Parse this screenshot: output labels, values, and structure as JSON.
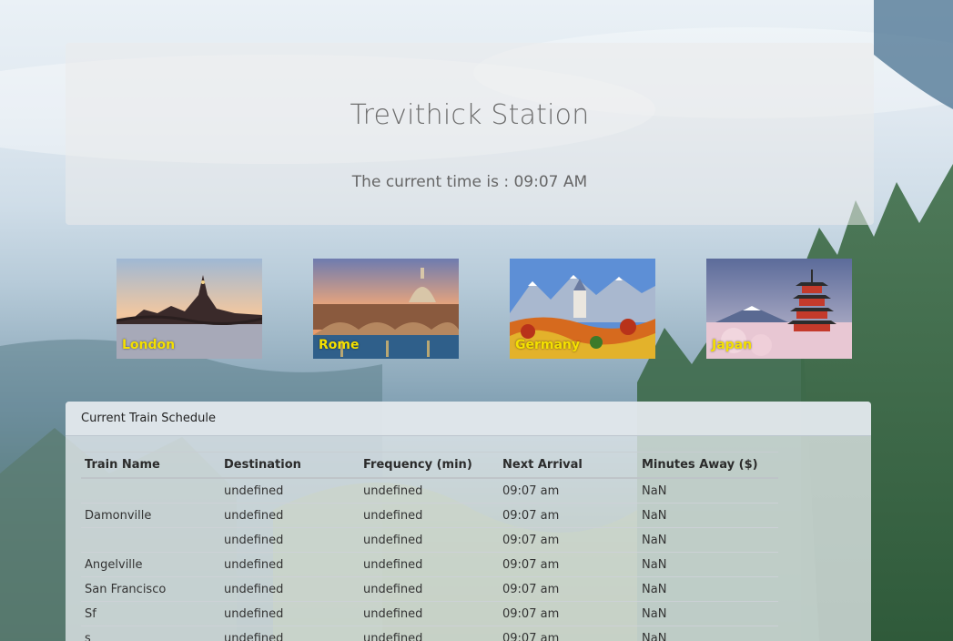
{
  "header": {
    "title": "Trevithick Station",
    "time_prefix": "The current time is : ",
    "time_value": "09:07 AM"
  },
  "destinations": [
    {
      "label": "London",
      "icon": "london-skyline-photo"
    },
    {
      "label": "Rome",
      "icon": "rome-basilica-photo"
    },
    {
      "label": "Germany",
      "icon": "neuschwanstein-castle-photo"
    },
    {
      "label": "Japan",
      "icon": "fuji-pagoda-photo"
    }
  ],
  "schedule": {
    "heading": "Current Train Schedule",
    "columns": [
      "Train Name",
      "Destination",
      "Frequency (min)",
      "Next Arrival",
      "Minutes Away ($)"
    ],
    "rows": [
      [
        "",
        "undefined",
        "undefined",
        "09:07 am",
        "NaN"
      ],
      [
        "Damonville",
        "undefined",
        "undefined",
        "09:07 am",
        "NaN"
      ],
      [
        "",
        "undefined",
        "undefined",
        "09:07 am",
        "NaN"
      ],
      [
        "Angelville",
        "undefined",
        "undefined",
        "09:07 am",
        "NaN"
      ],
      [
        "San Francisco",
        "undefined",
        "undefined",
        "09:07 am",
        "NaN"
      ],
      [
        "Sf",
        "undefined",
        "undefined",
        "09:07 am",
        "NaN"
      ],
      [
        "s",
        "undefined",
        "undefined",
        "09:07 am",
        "NaN"
      ]
    ]
  }
}
